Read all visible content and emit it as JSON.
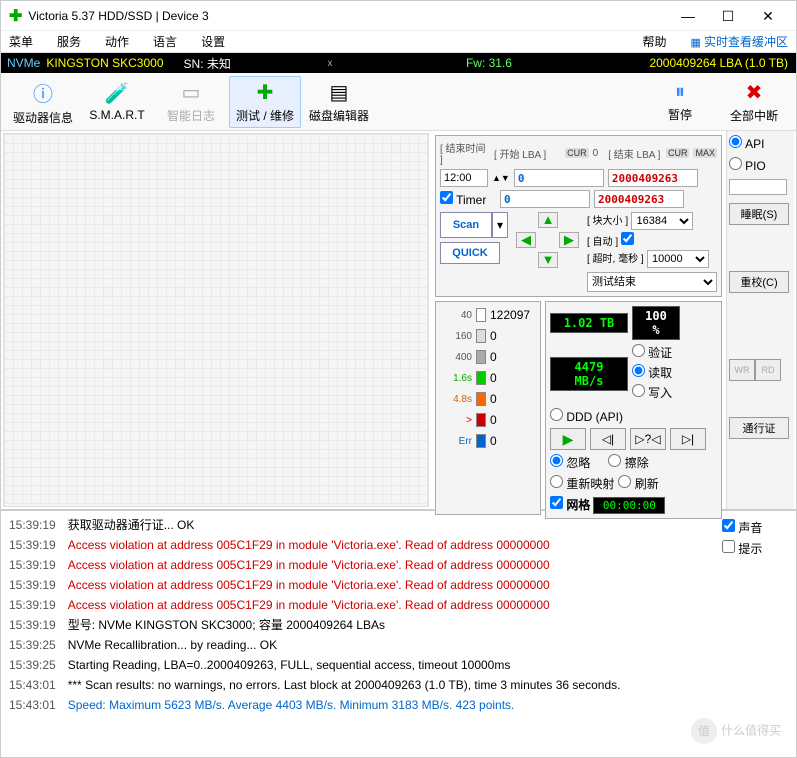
{
  "window": {
    "title": "Victoria 5.37 HDD/SSD | Device 3"
  },
  "menu": {
    "items": [
      "菜单",
      "服务",
      "动作",
      "语言",
      "设置"
    ],
    "help": "帮助",
    "realtime": "实时查看缓冲区"
  },
  "device": {
    "bus": "NVMe",
    "model": "KINGSTON SKC3000",
    "sn_label": "SN: 未知",
    "fw": "Fw: 31.6",
    "lba": "2000409264 LBA (1.0 TB)"
  },
  "toolbar": {
    "driveinfo": "驱动器信息",
    "smart": "S.M.A.R.T",
    "smartlog": "智能日志",
    "test": "测试 / 维修",
    "editor": "磁盘编辑器",
    "pause": "暂停",
    "stop": "全部中断"
  },
  "params": {
    "end_time_label": "[ 结束时间 ]",
    "start_lba_label": "[ 开始 LBA ]",
    "end_lba_label": "[ 结束 LBA ]",
    "cur": "CUR",
    "max": "MAX",
    "zero": "0",
    "time_value": "12:00",
    "timer_label": "Timer",
    "start_lba": "0",
    "cur_lba": "0",
    "end_lba": "2000409263",
    "end_lba2": "2000409263",
    "scan": "Scan",
    "quick": "QUICK",
    "blocksize_label": "[ 块大小 ]",
    "auto_label": "[ 自动 ]",
    "timeout_label": "[ 超时, 毫秒 ]",
    "blocksize": "16384",
    "timeout": "10000",
    "status": "测试结束"
  },
  "legend": {
    "r0": {
      "t": "40",
      "v": "122097"
    },
    "r1": {
      "t": "160",
      "v": "0"
    },
    "r2": {
      "t": "400",
      "v": "0"
    },
    "r3": {
      "t": "1.6s",
      "v": "0"
    },
    "r4": {
      "t": "4.8s",
      "v": "0"
    },
    "r5": {
      "t": ">",
      "v": "0"
    },
    "r6": {
      "t": "Err",
      "v": "0"
    }
  },
  "stats": {
    "size": "1.02 TB",
    "pct": "100   %",
    "speed": "4479 MB/s",
    "verify": "验证",
    "read": "读取",
    "write": "写入",
    "ddd": "DDD (API)",
    "ignore": "忽略",
    "erase": "擦除",
    "remap": "重新映射",
    "refresh": "刷新",
    "grid": "网格",
    "timer": "00:00:00"
  },
  "side": {
    "api": "API",
    "pio": "PIO",
    "sleep": "睡眠(S)",
    "recal": "重校(C)",
    "pass": "通行证",
    "wr": "WR",
    "rd": "RD"
  },
  "logside": {
    "sound": "声音",
    "hint": "提示"
  },
  "log": [
    {
      "ts": "15:39:19",
      "msg": "获取驱动器通行证... OK",
      "cls": ""
    },
    {
      "ts": "15:39:19",
      "msg": "Access violation at address 005C1F29 in module 'Victoria.exe'. Read of address 00000000",
      "cls": "red"
    },
    {
      "ts": "15:39:19",
      "msg": "Access violation at address 005C1F29 in module 'Victoria.exe'. Read of address 00000000",
      "cls": "red"
    },
    {
      "ts": "15:39:19",
      "msg": "Access violation at address 005C1F29 in module 'Victoria.exe'. Read of address 00000000",
      "cls": "red"
    },
    {
      "ts": "15:39:19",
      "msg": "Access violation at address 005C1F29 in module 'Victoria.exe'. Read of address 00000000",
      "cls": "red"
    },
    {
      "ts": "15:39:19",
      "msg": "型号: NVMe    KINGSTON SKC3000; 容量 2000409264 LBAs",
      "cls": ""
    },
    {
      "ts": "15:39:25",
      "msg": "NVMe Recallibration...  by reading... OK",
      "cls": ""
    },
    {
      "ts": "15:39:25",
      "msg": "Starting Reading, LBA=0..2000409263, FULL, sequential access, timeout 10000ms",
      "cls": ""
    },
    {
      "ts": "15:43:01",
      "msg": "*** Scan results: no warnings, no errors. Last block at 2000409263 (1.0 TB), time 3 minutes 36 seconds.",
      "cls": ""
    },
    {
      "ts": "15:43:01",
      "msg": "Speed: Maximum 5623 MB/s. Average 4403 MB/s. Minimum 3183 MB/s. 423 points.",
      "cls": "blue"
    }
  ],
  "watermark": "什么值得买"
}
